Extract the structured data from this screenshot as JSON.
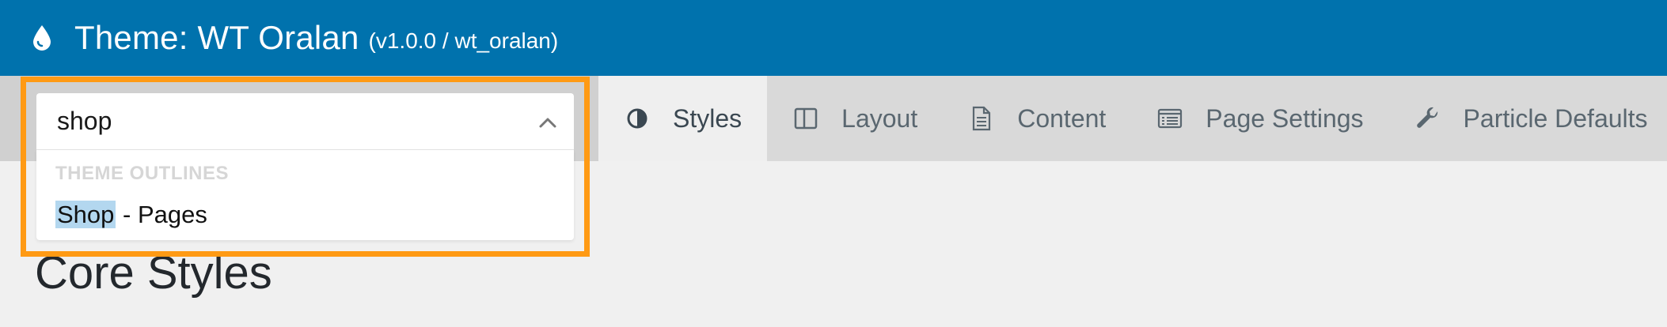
{
  "header": {
    "title": "Theme: WT Oralan",
    "version": "(v1.0.0 / wt_oralan)",
    "icon": "drop-icon"
  },
  "outline_selector": {
    "search_value": "shop",
    "group_label": "THEME OUTLINES",
    "option_match": "Shop",
    "option_rest": " - Pages",
    "highlight_color": "#ff9a14"
  },
  "tabs": [
    {
      "label": "Styles",
      "icon": "contrast-icon",
      "active": true
    },
    {
      "label": "Layout",
      "icon": "layout-columns-icon",
      "active": false
    },
    {
      "label": "Content",
      "icon": "document-icon",
      "active": false
    },
    {
      "label": "Page Settings",
      "icon": "page-settings-icon",
      "active": false
    },
    {
      "label": "Particle Defaults",
      "icon": "wrench-icon",
      "active": false
    }
  ],
  "main": {
    "heading": "Core Styles"
  },
  "colors": {
    "header_bg": "#0072ad",
    "nav_bg": "#d9d9d9",
    "active_tab_bg": "#efefef"
  }
}
